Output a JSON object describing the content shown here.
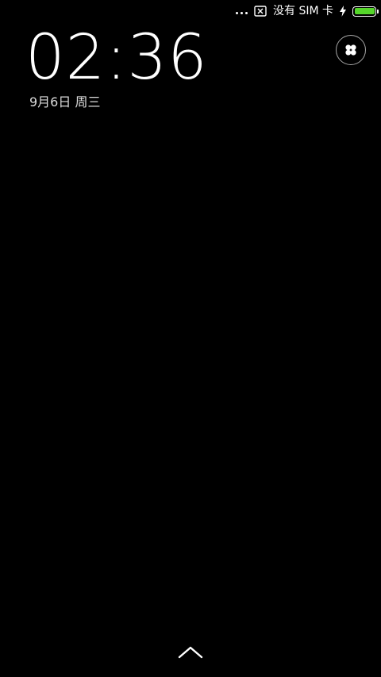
{
  "status_bar": {
    "carrier_text": "没有 SIM 卡",
    "icons": [
      "more-dots-icon",
      "sim-x-icon",
      "charging-icon",
      "battery-icon"
    ],
    "battery_level": 1.0,
    "battery_color": "#55d62a"
  },
  "lockscreen": {
    "time": "02:36",
    "date": "9月6日 周三"
  },
  "buttons": {
    "apps_icon": "four-petal-icon",
    "unlock_icon": "chevron-up-icon"
  }
}
